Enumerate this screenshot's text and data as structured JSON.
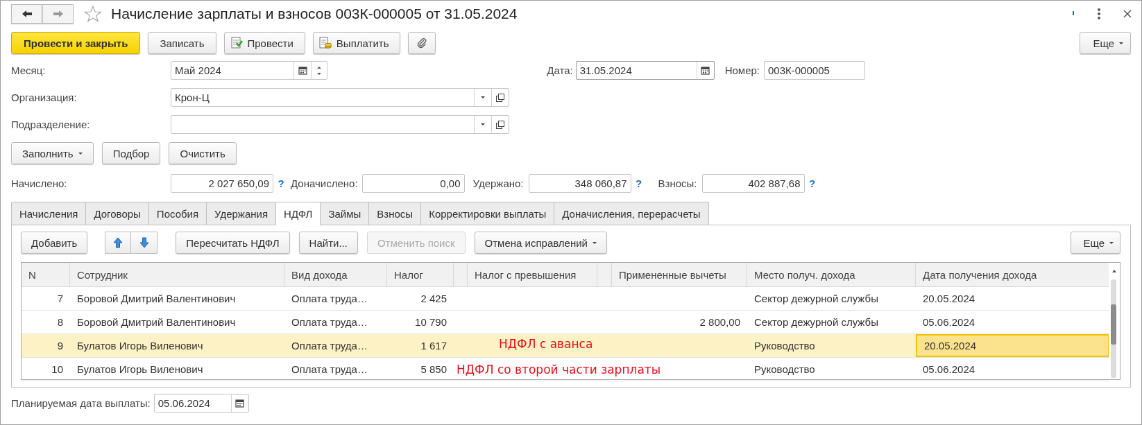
{
  "window": {
    "title": "Начисление зарплаты и взносов 003К-000005 от 31.05.2024"
  },
  "toolbar": [
    {
      "kind": "primary",
      "label": "Провести и закрыть"
    },
    {
      "kind": "plain",
      "label": "Записать"
    },
    {
      "kind": "post",
      "label": "Провести"
    },
    {
      "kind": "pay",
      "label": "Выплатить"
    },
    {
      "kind": "attach"
    }
  ],
  "more_button": "Еще",
  "month": {
    "label": "Месяц:",
    "value": "Май 2024"
  },
  "date": {
    "label": "Дата:",
    "value": "31.05.2024"
  },
  "number": {
    "label": "Номер:",
    "value": "003К-000005"
  },
  "organization": {
    "label": "Организация:",
    "value": "Крон-Ц"
  },
  "department": {
    "label": "Подразделение:"
  },
  "fill_buttons": [
    {
      "label": "Заполнить",
      "dropdown": true
    },
    {
      "label": "Подбор",
      "dropdown": false
    },
    {
      "label": "Очистить",
      "dropdown": false
    }
  ],
  "totals": [
    {
      "label": "Начислено:",
      "value": "2 027 650,09",
      "help": "?"
    },
    {
      "label": "Доначислено:",
      "value": "0,00"
    },
    {
      "label": "Удержано:",
      "value": "348 060,87",
      "help": "?"
    },
    {
      "label": "Взносы:",
      "value": "402 887,68",
      "help": "?"
    }
  ],
  "tabs": [
    {
      "label": "Начисления",
      "selected": false
    },
    {
      "label": "Договоры",
      "selected": false
    },
    {
      "label": "Пособия",
      "selected": false
    },
    {
      "label": "Удержания",
      "selected": false
    },
    {
      "label": "НДФЛ",
      "selected": true
    },
    {
      "label": "Займы",
      "selected": false
    },
    {
      "label": "Взносы",
      "selected": false
    },
    {
      "label": "Корректировки выплаты",
      "selected": false
    },
    {
      "label": "Доначисления, перерасчеты",
      "selected": false
    }
  ],
  "table_toolbar": [
    {
      "kind": "button",
      "label": "Добавить",
      "dropdown": false,
      "disabled": false
    },
    {
      "kind": "arrows"
    },
    {
      "kind": "button",
      "label": "Пересчитать НДФЛ",
      "dropdown": false,
      "disabled": false
    },
    {
      "kind": "button",
      "label": "Найти...",
      "dropdown": false,
      "disabled": false
    },
    {
      "kind": "button",
      "label": "Отменить поиск",
      "dropdown": false,
      "disabled": true
    },
    {
      "kind": "button",
      "label": "Отмена исправлений",
      "dropdown": true,
      "disabled": false
    }
  ],
  "table_more_button": "Еще",
  "table": {
    "columns": [
      "N",
      "Сотрудник",
      "Вид дохода",
      "Налог",
      "Налог с превышения",
      "Примененные вычеты",
      "Место получ. дохода",
      "Дата получения дохода"
    ],
    "rows": [
      {
        "n": "7",
        "employee": "Боровой Дмитрий Валентинович",
        "income": "Оплата труда…",
        "tax": "2 425",
        "place": "Сектор дежурной службы",
        "date": "20.05.2024",
        "selected": false,
        "date_focused": false
      },
      {
        "n": "8",
        "employee": "Боровой Дмитрий Валентинович",
        "income": "Оплата труда…",
        "tax": "10 790",
        "deductions": "2 800,00",
        "place": "Сектор дежурной службы",
        "date": "05.06.2024",
        "selected": false,
        "date_focused": false
      },
      {
        "n": "9",
        "employee": "Булатов Игорь Виленович",
        "income": "Оплата труда…",
        "tax": "1 617",
        "place": "Руководство",
        "date": "20.05.2024",
        "selected": true,
        "date_focused": true,
        "note": "НДФЛ с аванса"
      },
      {
        "n": "10",
        "employee": "Булатов Игорь Виленович",
        "income": "Оплата труда…",
        "tax": "5 850",
        "place": "Руководство",
        "date": "05.06.2024",
        "selected": false,
        "date_focused": false,
        "note": "НДФЛ со второй части зарплаты"
      }
    ]
  },
  "planned_date": {
    "label": "Планируемая дата выплаты:",
    "value": "05.06.2024"
  }
}
